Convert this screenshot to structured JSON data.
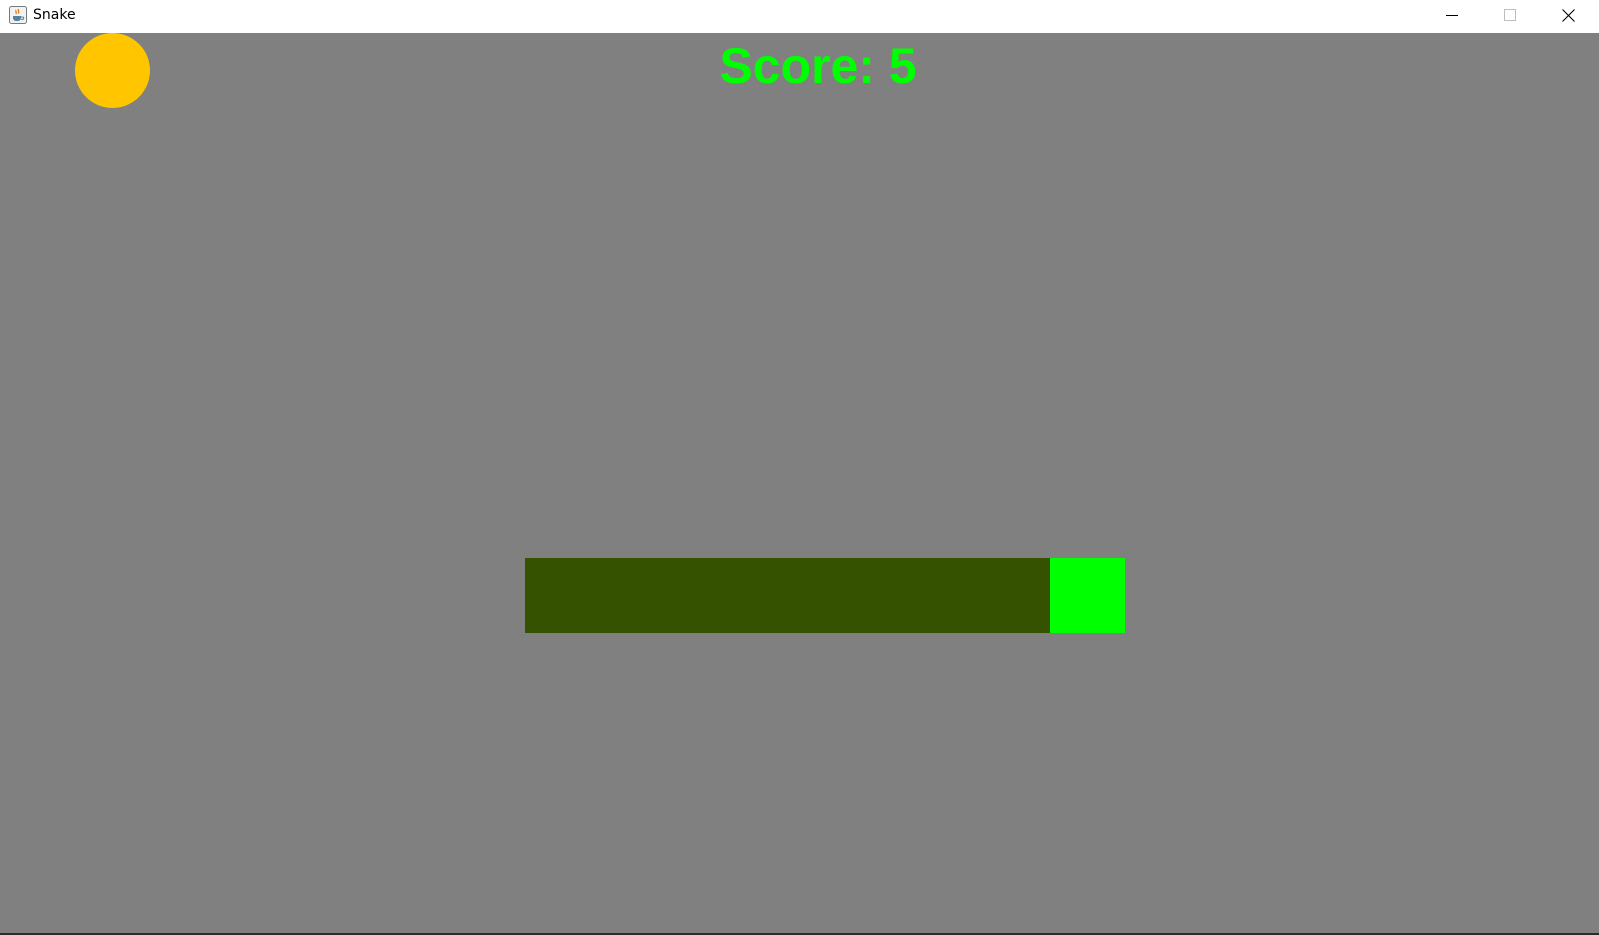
{
  "window": {
    "title": "Snake",
    "icon": "java-cup-icon"
  },
  "game": {
    "score_text": "Score: 5",
    "score": 5,
    "colors": {
      "background": "#808080",
      "score": "#00ff00",
      "food": "#ffc600",
      "snake_head": "#00ff00",
      "snake_body": "#345200"
    },
    "snake": {
      "head": "snake-head",
      "body_segments": 7
    }
  }
}
